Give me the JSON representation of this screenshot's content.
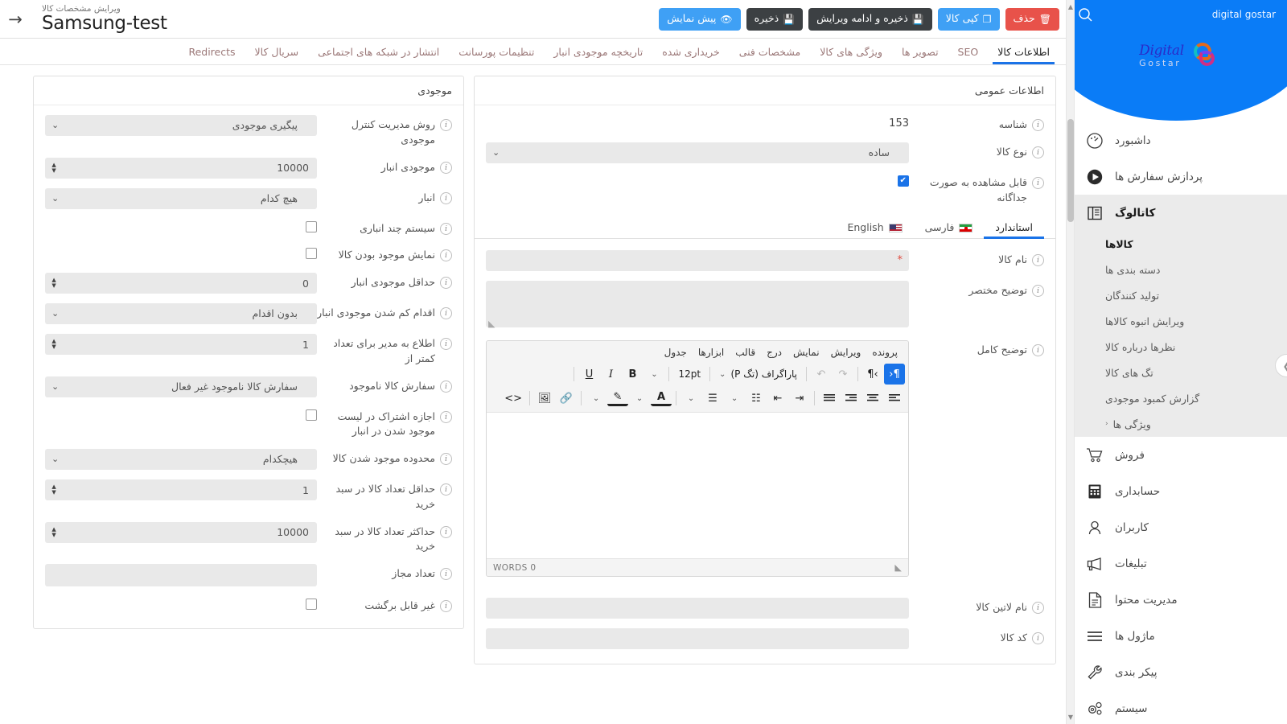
{
  "topbar": {
    "subtitle": "ویرایش مشخصات کالا",
    "title": "Samsung-test",
    "back_icon": "arrow-right-icon",
    "buttons": [
      {
        "label": "حذف",
        "icon": "trash-icon",
        "color": "#e8524a",
        "style": "red"
      },
      {
        "label": "کپی کالا",
        "icon": "copy-icon",
        "color": "#3fa0f5",
        "style": "blue"
      },
      {
        "label": "ذخیره و ادامه ویرایش",
        "icon": "save-continue-icon",
        "color": "#3c4043",
        "style": "dark"
      },
      {
        "label": "ذخیره",
        "icon": "save-icon",
        "color": "#3c4043",
        "style": "dark"
      },
      {
        "label": "پیش نمایش",
        "icon": "eye-icon",
        "color": "#3fa0f5",
        "style": "blue"
      }
    ]
  },
  "tabs": [
    {
      "label": "اطلاعات کالا",
      "active": true
    },
    {
      "label": "SEO",
      "active": false,
      "latin": true
    },
    {
      "label": "تصویر ها",
      "active": false
    },
    {
      "label": "ویژگی های کالا",
      "active": false
    },
    {
      "label": "مشخصات فنی",
      "active": false
    },
    {
      "label": "خریداری شده",
      "active": false
    },
    {
      "label": "تاریخچه موجودی انبار",
      "active": false
    },
    {
      "label": "تنظیمات پورسانت",
      "active": false
    },
    {
      "label": "انتشار در شبکه های اجتماعی",
      "active": false
    },
    {
      "label": "سریال کالا",
      "active": false
    },
    {
      "label": "Redirects",
      "active": false,
      "latin": true
    }
  ],
  "general": {
    "card_title": "اطلاعات عمومی",
    "id_label": "شناسه",
    "id_value": "153",
    "type_label": "نوع کالا",
    "type_value": "ساده",
    "visible_label": "قابل مشاهده به صورت جداگانه",
    "visible_checked": true,
    "lang_tabs": [
      {
        "label": "استاندارد",
        "flag": "none",
        "active": true
      },
      {
        "label": "فارسی",
        "flag": "ir",
        "active": false
      },
      {
        "label": "English",
        "flag": "us",
        "active": false
      }
    ],
    "name_label": "نام کالا",
    "name_value": "",
    "name_required": "*",
    "short_desc_label": "توضیح مختصر",
    "short_desc_value": "",
    "full_desc_label": "توضیح کامل",
    "latin_name_label": "نام لاتین کالا",
    "latin_name_value": "",
    "code_label": "کد کالا",
    "code_value": ""
  },
  "editor": {
    "menus": [
      "پرونده",
      "ویرایش",
      "نمایش",
      "درج",
      "قالب",
      "ابزارها",
      "جدول"
    ],
    "dir_rtl_icon": "paragraph-rtl-icon",
    "dir_ltr_icon": "paragraph-ltr-icon",
    "dir_rtl_active": true,
    "redo_icon": "redo-icon",
    "undo_icon": "undo-icon",
    "block_format": "پاراگراف (تگ P)",
    "font_size": "12pt",
    "bold_icon": "bold-icon",
    "italic_icon": "italic-icon",
    "underline_icon": "underline-icon",
    "more_icon": "chevron-down-icon",
    "align_left_icon": "align-left-icon",
    "align_center_icon": "align-center-icon",
    "align_right_icon": "align-right-icon",
    "align_justify_icon": "align-justify-icon",
    "outdent_icon": "outdent-icon",
    "indent_icon": "indent-icon",
    "bullet_list_icon": "bullet-list-icon",
    "numbered_list_icon": "numbered-list-icon",
    "text_color_icon": "text-color-icon",
    "highlight_icon": "highlight-color-icon",
    "link_icon": "link-icon",
    "image_icon": "image-icon",
    "source_code_icon": "source-code-icon",
    "status_words": "WORDS 0",
    "body_value": ""
  },
  "inventory": {
    "card_title": "موجودی",
    "rows": [
      {
        "label": "روش مدیریت کنترل موجودی",
        "kind": "select",
        "value": "پیگیری موجودی"
      },
      {
        "label": "موجودی انبار",
        "kind": "number",
        "value": "10000"
      },
      {
        "label": "انبار",
        "kind": "select",
        "value": "هیچ کدام"
      },
      {
        "label": "سیستم چند انباری",
        "kind": "checkbox",
        "checked": false
      },
      {
        "label": "نمایش موجود بودن کالا",
        "kind": "checkbox",
        "checked": false
      },
      {
        "label": "حداقل موجودی انبار",
        "kind": "number",
        "value": "0"
      },
      {
        "label": "اقدام کم شدن موجودی انبار",
        "kind": "select",
        "value": "بدون اقدام"
      },
      {
        "label": "اطلاع به مدیر برای تعداد کمتر از",
        "kind": "number",
        "value": "1"
      },
      {
        "label": "سفارش کالا ناموجود",
        "kind": "select",
        "value": "سفارش کالا ناموجود غیر فعال"
      },
      {
        "label": "اجازه اشتراک در لیست موجود شدن در انبار",
        "kind": "checkbox",
        "checked": false
      },
      {
        "label": "محدوده موجود شدن کالا",
        "kind": "select",
        "value": "هیچکدام"
      },
      {
        "label": "حداقل تعداد کالا در سبد خرید",
        "kind": "number",
        "value": "1"
      },
      {
        "label": "حداکثر تعداد کالا در سبد خرید",
        "kind": "number",
        "value": "10000"
      },
      {
        "label": "تعداد مجاز",
        "kind": "text",
        "value": ""
      },
      {
        "label": "غیر قابل برگشت",
        "kind": "checkbox",
        "checked": false
      }
    ]
  },
  "sidebar": {
    "search_text": "digital gostar",
    "search_icon": "search-icon",
    "logo_line1": "Digital",
    "logo_line2": "Gostar",
    "collapse_icon": "chevron-right-icon",
    "items": [
      {
        "label": "داشبورد",
        "icon": "dashboard-icon",
        "active": false
      },
      {
        "label": "پردازش سفارش ها",
        "icon": "play-circle-icon",
        "active": false
      },
      {
        "label": "کاتالوگ",
        "icon": "book-icon",
        "active": true
      }
    ],
    "catalog_sub": [
      {
        "label": "کالاها",
        "current": true
      },
      {
        "label": "دسته بندی ها",
        "current": false
      },
      {
        "label": "تولید کنندگان",
        "current": false
      },
      {
        "label": "ویرایش انبوه کالاها",
        "current": false
      },
      {
        "label": "نظرها درباره کالا",
        "current": false
      },
      {
        "label": "تگ های کالا",
        "current": false
      },
      {
        "label": "گزارش کمبود موجودی",
        "current": false
      },
      {
        "label": "ویژگی ها",
        "current": false,
        "caret": "‹"
      }
    ],
    "items_bottom": [
      {
        "label": "فروش",
        "icon": "cart-icon"
      },
      {
        "label": "حسابداری",
        "icon": "calculator-icon"
      },
      {
        "label": "کاربران",
        "icon": "user-icon"
      },
      {
        "label": "تبلیغات",
        "icon": "megaphone-icon"
      },
      {
        "label": "مدیریت محتوا",
        "icon": "document-icon"
      },
      {
        "label": "ماژول ها",
        "icon": "menu-lines-icon"
      },
      {
        "label": "پیکر بندی",
        "icon": "wrench-icon"
      },
      {
        "label": "سیستم",
        "icon": "gears-icon"
      }
    ]
  },
  "colors": {
    "accent": "#1a73e8",
    "brand_blue": "#0a7cf7",
    "danger": "#e8524a",
    "dark": "#3c4043"
  }
}
